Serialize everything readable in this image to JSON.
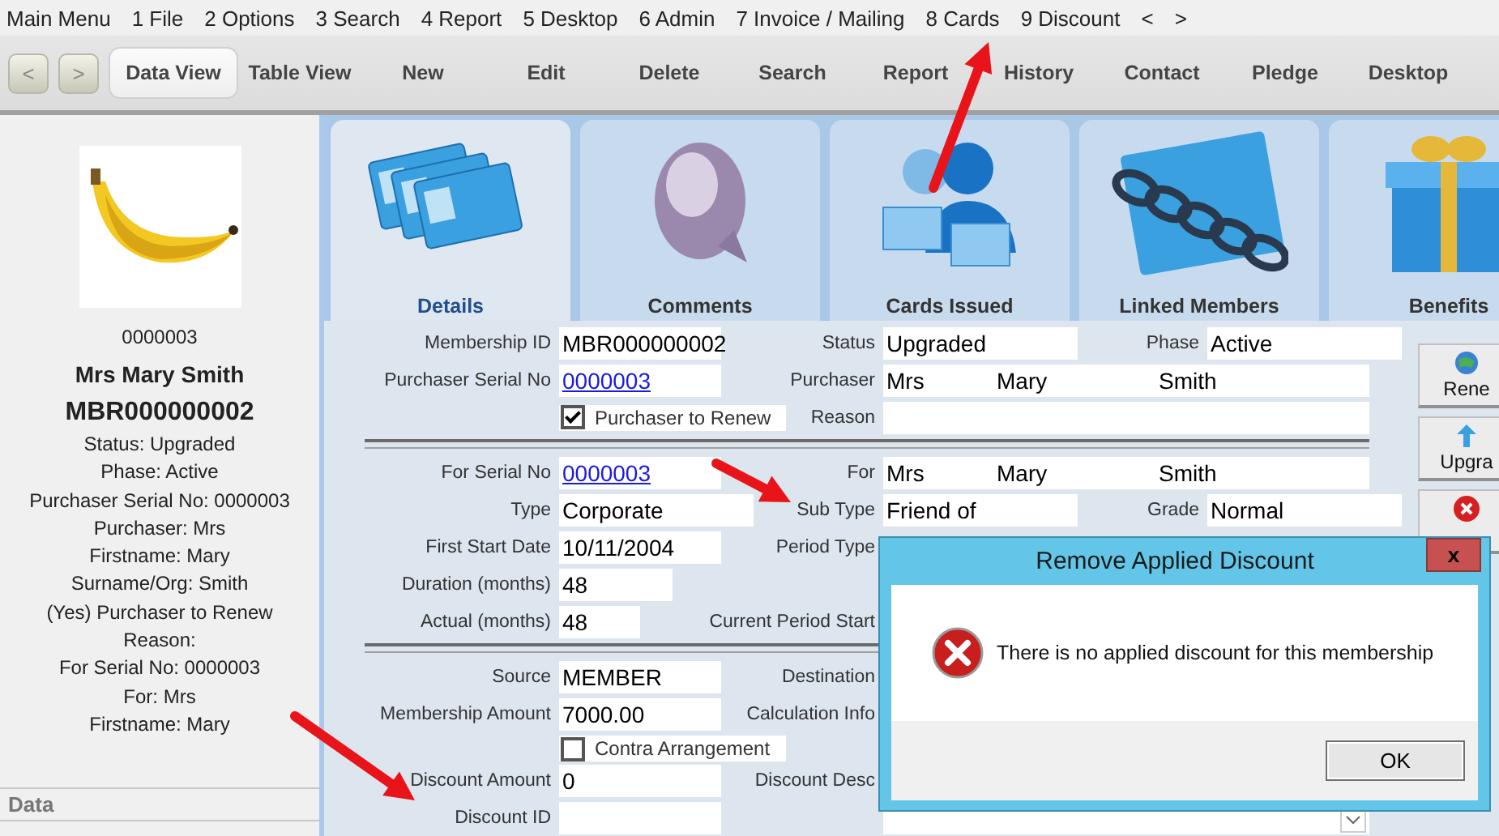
{
  "menu_bar": [
    {
      "label": "Main Menu"
    },
    {
      "label": "1 File"
    },
    {
      "label": "2 Options"
    },
    {
      "label": "3 Search"
    },
    {
      "label": "4 Report"
    },
    {
      "label": "5 Desktop"
    },
    {
      "label": "6 Admin"
    },
    {
      "label": "7 Invoice / Mailing"
    },
    {
      "label": "8 Cards"
    },
    {
      "label": "9 Discount"
    },
    {
      "label": "<"
    },
    {
      "label": ">"
    }
  ],
  "toolbar": {
    "nav": [
      "<",
      ">"
    ],
    "items": [
      {
        "label": "Data View",
        "selected": true
      },
      {
        "label": "Table View",
        "selected": false
      },
      {
        "label": "New",
        "selected": false
      },
      {
        "label": "Edit",
        "selected": false
      },
      {
        "label": "Delete",
        "selected": false
      },
      {
        "label": "Search",
        "selected": false
      },
      {
        "label": "Report",
        "selected": false
      },
      {
        "label": "History",
        "selected": false
      },
      {
        "label": "Contact",
        "selected": false
      },
      {
        "label": "Pledge",
        "selected": false
      },
      {
        "label": "Desktop",
        "selected": false
      }
    ]
  },
  "sidebar": {
    "lines": [
      {
        "kind": "serial",
        "text": "0000003"
      },
      {
        "kind": "name",
        "text": "Mrs Mary Smith"
      },
      {
        "kind": "code",
        "text": "MBR000000002"
      },
      {
        "kind": "info",
        "text": "Status: Upgraded"
      },
      {
        "kind": "info",
        "text": "Phase: Active"
      },
      {
        "kind": "info",
        "text": "Purchaser Serial No: 0000003"
      },
      {
        "kind": "info",
        "text": "Purchaser: Mrs"
      },
      {
        "kind": "info",
        "text": "Firstname: Mary"
      },
      {
        "kind": "info",
        "text": "Surname/Org: Smith"
      },
      {
        "kind": "info",
        "text": "(Yes) Purchaser to Renew"
      },
      {
        "kind": "info",
        "text": "Reason:"
      },
      {
        "kind": "info",
        "text": "For Serial No: 0000003"
      },
      {
        "kind": "info",
        "text": "For: Mrs"
      },
      {
        "kind": "info",
        "text": "Firstname: Mary"
      }
    ],
    "footer": "Data"
  },
  "tiles": [
    {
      "label": "Details",
      "kind": "cards",
      "selected": true
    },
    {
      "label": "Comments",
      "kind": "bubble",
      "selected": false
    },
    {
      "label": "Cards Issued",
      "kind": "people",
      "selected": false
    },
    {
      "label": "Linked Members",
      "kind": "chain",
      "selected": false
    },
    {
      "label": "Benefits",
      "kind": "gift",
      "selected": false
    }
  ],
  "form": {
    "rows": [
      {
        "kind": "row",
        "cells": [
          {
            "kind": "text",
            "label": "Membership ID",
            "value": "MBR000000002"
          },
          {
            "kind": "text",
            "label": "Status",
            "value": "Upgraded"
          },
          {
            "kind": "text",
            "label": "Phase",
            "value": "Active"
          }
        ]
      },
      {
        "kind": "row",
        "cells": [
          {
            "kind": "link",
            "label": "Purchaser Serial No",
            "value": "0000003"
          },
          {
            "kind": "name",
            "label": "Purchaser",
            "parts": [
              "Mrs",
              "Mary",
              "Smith"
            ]
          },
          null
        ]
      },
      {
        "kind": "row",
        "cells": [
          {
            "kind": "checkbox",
            "text": "Purchaser to Renew",
            "checked": true
          },
          {
            "kind": "text",
            "label": "Reason"
          },
          null
        ]
      },
      {
        "kind": "divider"
      },
      {
        "kind": "row",
        "cells": [
          {
            "kind": "link",
            "label": "For Serial No",
            "value": "0000003"
          },
          {
            "kind": "name",
            "label": "For",
            "parts": [
              "Mrs",
              "Mary",
              "Smith"
            ]
          },
          null
        ]
      },
      {
        "kind": "row",
        "cells": [
          {
            "kind": "text",
            "label": "Type",
            "value": "Corporate"
          },
          {
            "kind": "text",
            "label": "Sub Type",
            "value": "Friend of"
          },
          {
            "kind": "text",
            "label": "Grade",
            "value": "Normal"
          }
        ]
      },
      {
        "kind": "row",
        "cells": [
          {
            "kind": "text",
            "label": "First Start Date",
            "value": "10/11/2004"
          },
          {
            "kind": "label",
            "label": "Period Type"
          },
          null
        ]
      },
      {
        "kind": "row",
        "cells": [
          {
            "kind": "text",
            "label": "Duration (months)",
            "value": "48"
          },
          null,
          null
        ]
      },
      {
        "kind": "row",
        "cells": [
          {
            "kind": "text",
            "label": "Actual (months)",
            "value": "48"
          },
          {
            "kind": "label",
            "label": "Current Period Start"
          },
          null
        ]
      },
      {
        "kind": "divider"
      },
      {
        "kind": "row",
        "cells": [
          {
            "kind": "text",
            "label": "Source",
            "value": "MEMBER"
          },
          {
            "kind": "label",
            "label": "Destination"
          },
          null
        ]
      },
      {
        "kind": "row",
        "cells": [
          {
            "kind": "text",
            "label": "Membership Amount",
            "value": "7000.00"
          },
          {
            "kind": "label",
            "label": "Calculation Info"
          },
          null
        ]
      },
      {
        "kind": "row",
        "cells": [
          {
            "kind": "checkbox",
            "text": "Contra Arrangement",
            "checked": false
          },
          null,
          null
        ]
      },
      {
        "kind": "row",
        "cells": [
          {
            "kind": "text",
            "label": "Discount Amount",
            "value": "0"
          },
          {
            "kind": "label",
            "label": "Discount Desc"
          },
          null
        ]
      },
      {
        "kind": "row",
        "cells": [
          {
            "kind": "text",
            "label": "Discount ID"
          },
          {
            "kind": "select"
          },
          null
        ]
      }
    ]
  },
  "side_buttons": [
    {
      "kind": "renew",
      "label": "Rene"
    },
    {
      "kind": "upgrade",
      "label": "Upgra"
    },
    {
      "kind": "cancel"
    }
  ],
  "dialog": {
    "title": "Remove Applied Discount",
    "close": "x",
    "kind": "error",
    "message": "There is no applied discount for this membership",
    "button": "OK"
  }
}
